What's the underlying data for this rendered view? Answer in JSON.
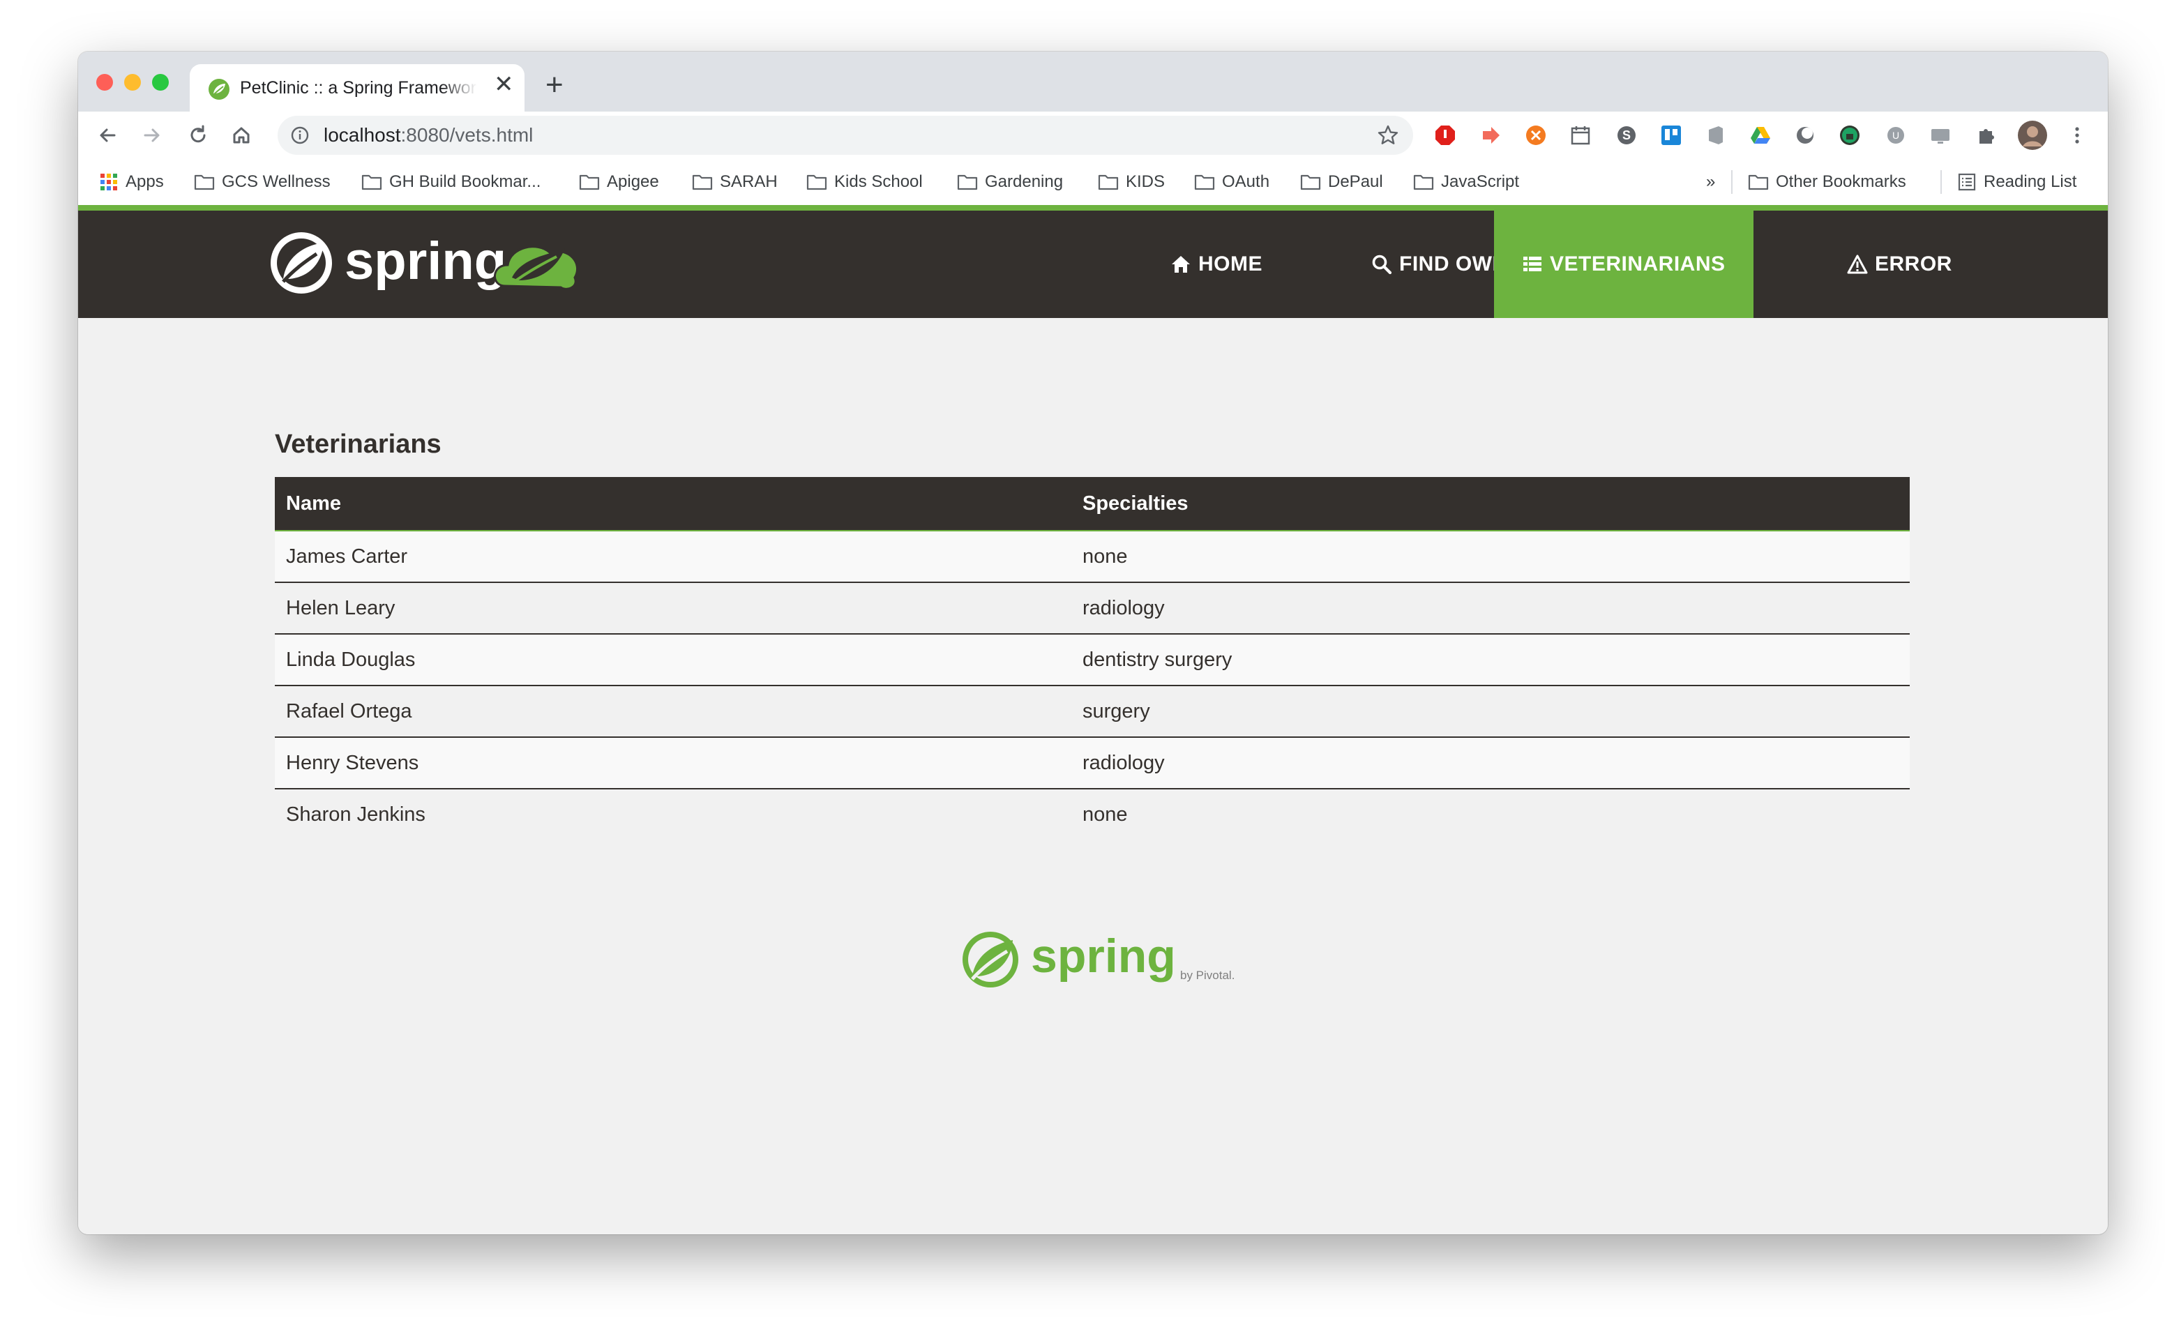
{
  "browser": {
    "tab_title": "PetClinic :: a Spring Framework demonstration",
    "new_tab_label": "+",
    "close_tab_label": "✕",
    "url_host": "localhost",
    "url_rest": ":8080/vets.html"
  },
  "bookmarks": {
    "apps": "Apps",
    "items": [
      "GCS Wellness",
      "GH Build Bookmar...",
      "Apigee",
      "SARAH",
      "Kids School",
      "Gardening",
      "KIDS",
      "OAuth",
      "DePaul",
      "JavaScript"
    ],
    "overflow": "»",
    "other": "Other Bookmarks",
    "reading_list": "Reading List"
  },
  "navbar": {
    "items": [
      {
        "label": "HOME",
        "icon": "home-icon"
      },
      {
        "label": "FIND OWNERS",
        "icon": "search-icon"
      },
      {
        "label": "VETERINARIANS",
        "icon": "list-icon",
        "active": true
      },
      {
        "label": "ERROR",
        "icon": "warning-icon"
      }
    ]
  },
  "page": {
    "title": "Veterinarians",
    "columns": [
      "Name",
      "Specialties"
    ],
    "rows": [
      {
        "name": "James Carter",
        "specialties": "none"
      },
      {
        "name": "Helen Leary",
        "specialties": "radiology"
      },
      {
        "name": "Linda Douglas",
        "specialties": "dentistry surgery"
      },
      {
        "name": "Rafael Ortega",
        "specialties": "surgery"
      },
      {
        "name": "Henry Stevens",
        "specialties": "radiology"
      },
      {
        "name": "Sharon Jenkins",
        "specialties": "none"
      }
    ]
  },
  "branding": {
    "logo_text": "spring",
    "footer_logo_text": "spring",
    "footer_by": "by Pivotal."
  },
  "colors": {
    "spring_green": "#6db33f",
    "navbar_dark": "#34302d",
    "page_bg": "#f1f1f1"
  }
}
